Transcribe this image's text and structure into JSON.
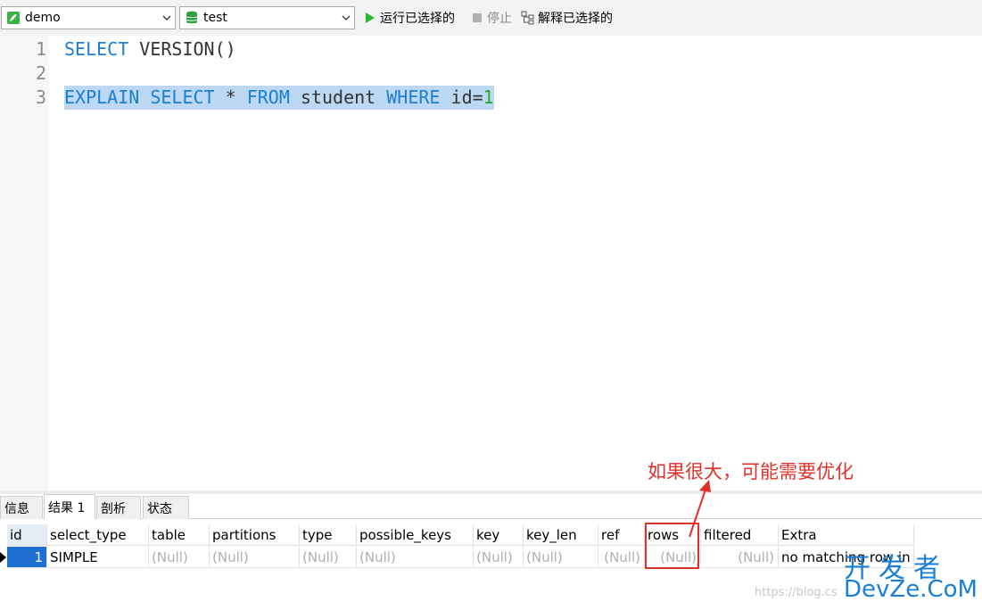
{
  "toolbar": {
    "connection": "demo",
    "database": "test",
    "run_selected_label": "运行已选择的",
    "stop_label": "停止",
    "explain_selected_label": "解释已选择的",
    "colors": {
      "run_green": "#2eb82e",
      "db_green": "#2ea043"
    }
  },
  "editor": {
    "lines": [
      {
        "number": "1",
        "tokens": [
          {
            "text": "SELECT",
            "type": "keyword"
          },
          {
            "text": " VERSION()",
            "type": "plain"
          }
        ]
      },
      {
        "number": "2",
        "tokens": []
      },
      {
        "number": "3",
        "tokens": [
          {
            "text": "EXPLAIN",
            "type": "keyword"
          },
          {
            "text": " ",
            "type": "plain"
          },
          {
            "text": "SELECT",
            "type": "keyword"
          },
          {
            "text": " * ",
            "type": "plain"
          },
          {
            "text": "FROM",
            "type": "keyword"
          },
          {
            "text": " student ",
            "type": "plain"
          },
          {
            "text": "WHERE",
            "type": "keyword"
          },
          {
            "text": " id=",
            "type": "plain"
          },
          {
            "text": "1",
            "type": "number"
          }
        ]
      }
    ],
    "colors": {
      "keyword": "#1a7fd6",
      "number": "#27a92e",
      "selection": "#bcd8f2"
    }
  },
  "result_tabs": [
    {
      "label": "信息",
      "active": false
    },
    {
      "label": "结果 1",
      "active": true
    },
    {
      "label": "剖析",
      "active": false
    },
    {
      "label": "状态",
      "active": false
    }
  ],
  "grid": {
    "columns": [
      "id",
      "select_type",
      "table",
      "partitions",
      "type",
      "possible_keys",
      "key",
      "key_len",
      "ref",
      "rows",
      "filtered",
      "Extra"
    ],
    "rows": [
      [
        "1",
        "SIMPLE",
        "(Null)",
        "(Null)",
        "(Null)",
        "(Null)",
        "(Null)",
        "(Null)",
        "(Null)",
        "(Null)",
        "(Null)",
        "no matching row in"
      ]
    ]
  },
  "annotation": {
    "text": "如果很大，可能需要优化",
    "color": "#e0302a"
  },
  "watermark": {
    "url": "https://blog.cs",
    "logo_top": "开发者",
    "logo_bottom": "DevZe.CoM"
  }
}
